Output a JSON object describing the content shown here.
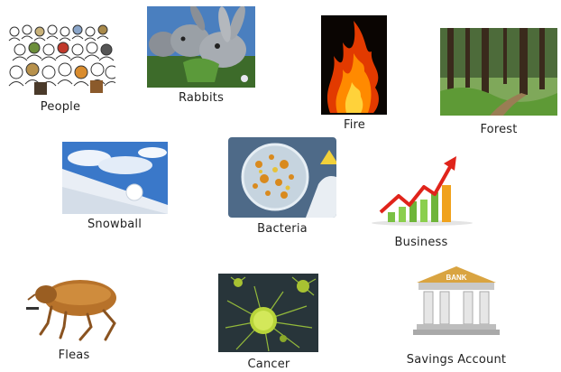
{
  "items": [
    {
      "key": "people",
      "label": "People",
      "icon": "crowd-icon"
    },
    {
      "key": "rabbits",
      "label": "Rabbits",
      "icon": "rabbit-icon"
    },
    {
      "key": "fire",
      "label": "Fire",
      "icon": "flame-icon"
    },
    {
      "key": "forest",
      "label": "Forest",
      "icon": "tree-icon"
    },
    {
      "key": "snowball",
      "label": "Snowball",
      "icon": "snowball-icon"
    },
    {
      "key": "bacteria",
      "label": "Bacteria",
      "icon": "petri-dish-icon"
    },
    {
      "key": "business",
      "label": "Business",
      "icon": "growth-chart-icon"
    },
    {
      "key": "fleas",
      "label": "Fleas",
      "icon": "flea-icon"
    },
    {
      "key": "cancer",
      "label": "Cancer",
      "icon": "cell-icon"
    },
    {
      "key": "savings",
      "label": "Savings Account",
      "icon": "bank-icon"
    }
  ],
  "bank_sign": "BANK",
  "colors": {
    "flame": "#ff6a00",
    "forest_green": "#4f8a2a",
    "sky_blue": "#3a78c9",
    "arrow_red": "#e0241b",
    "bank_gold": "#d9a441"
  }
}
